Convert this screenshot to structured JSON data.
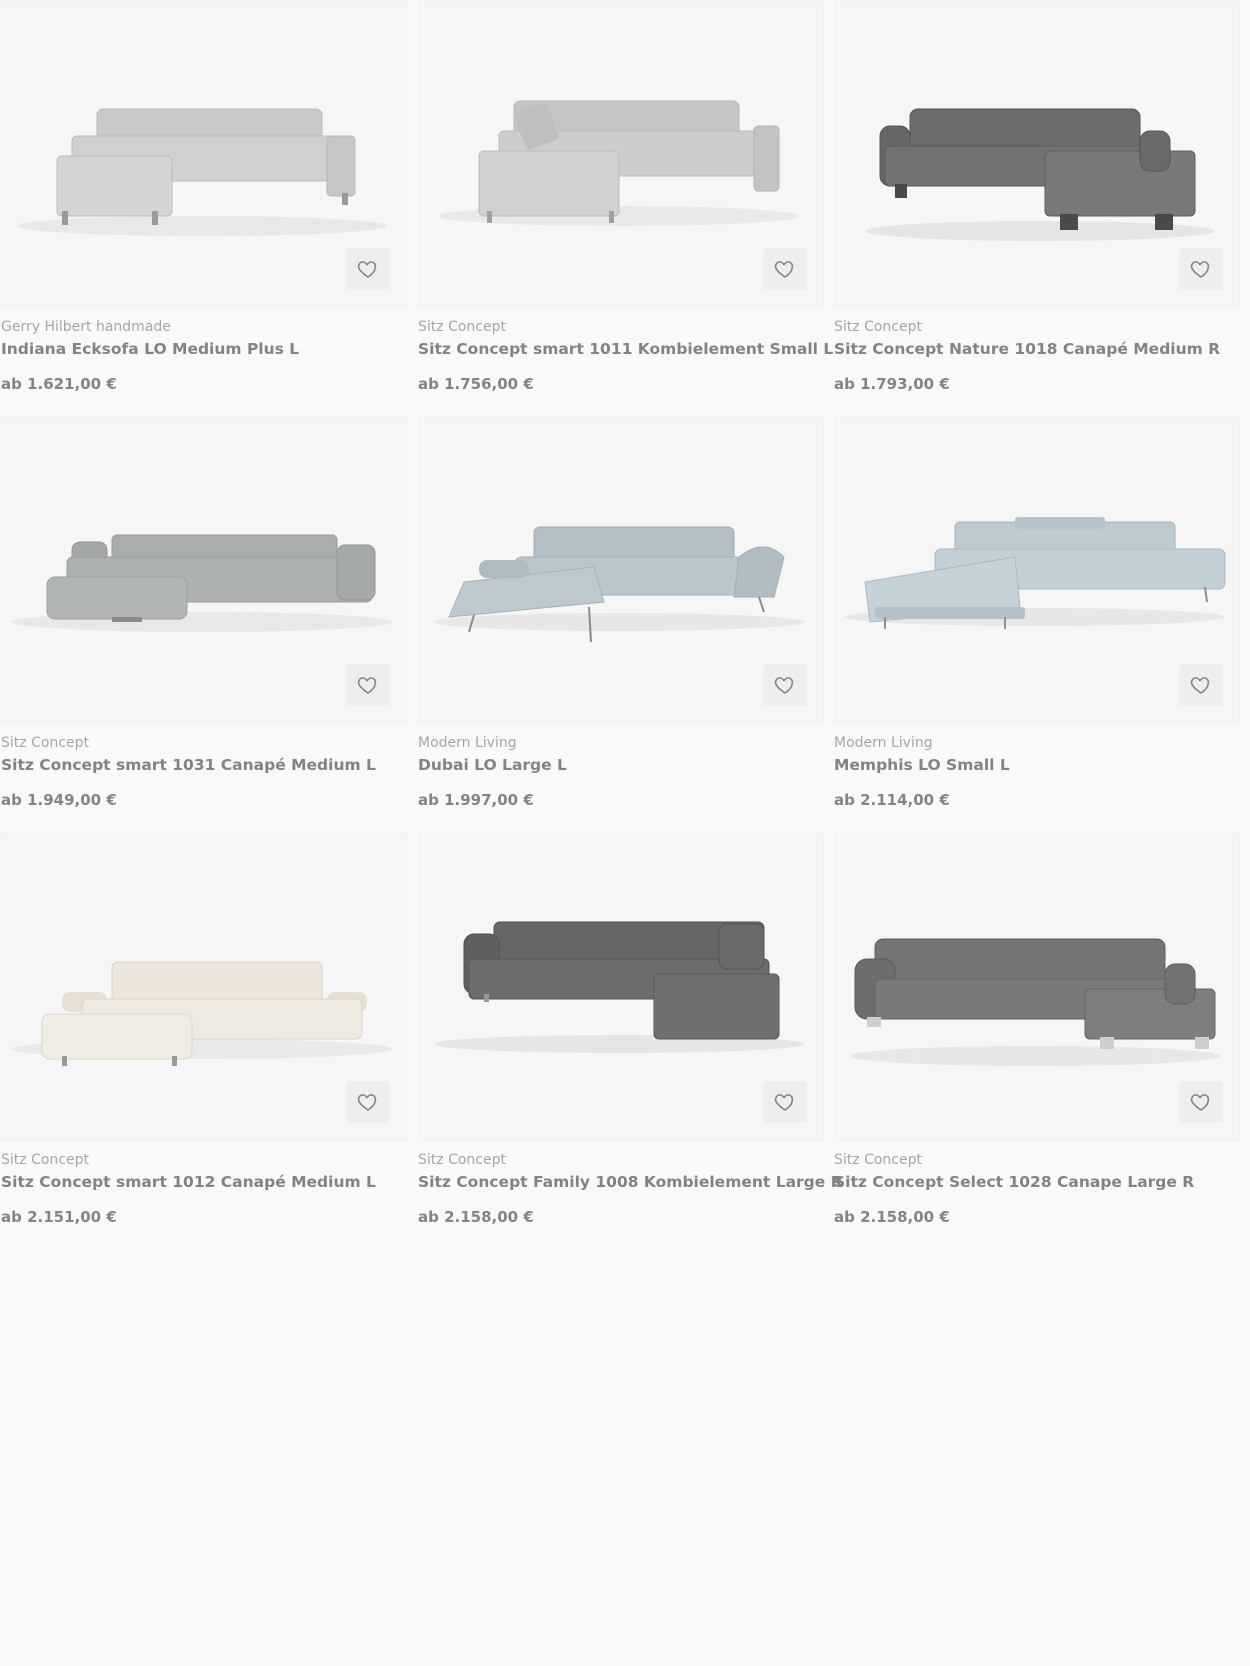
{
  "products": [
    {
      "brand": "Gerry Hilbert handmade",
      "title": "Indiana Ecksofa LO Medium Plus L",
      "price": "ab 1.621,00 €",
      "color": "#c9c9c9",
      "image": "l-sofa-left-chaise"
    },
    {
      "brand": "Sitz Concept",
      "title": "Sitz Concept smart 1011 Kombielement Small L",
      "price": "ab 1.756,00 €",
      "color": "#c5c5c5",
      "image": "l-sofa-left-chaise"
    },
    {
      "brand": "Sitz Concept",
      "title": "Sitz Concept Nature 1018 Canapé Medium R",
      "price": "ab 1.793,00 €",
      "color": "#6c6c6c",
      "image": "l-sofa-right-chaise"
    },
    {
      "brand": "Sitz Concept",
      "title": "Sitz Concept smart 1031 Canapé Medium L",
      "price": "ab 1.949,00 €",
      "color": "#a9adae",
      "image": "l-sofa-left-chaise"
    },
    {
      "brand": "Modern Living",
      "title": "Dubai LO Large L",
      "price": "ab 1.997,00 €",
      "color": "#b3c0c5",
      "image": "l-sofa-left-chaise"
    },
    {
      "brand": "Modern Living",
      "title": "Memphis LO Small L",
      "price": "ab 2.114,00 €",
      "color": "#bccbd2",
      "image": "l-sofa-left-chaise"
    },
    {
      "brand": "Sitz Concept",
      "title": "Sitz Concept smart 1012 Canapé Medium L",
      "price": "ab 2.151,00 €",
      "color": "#ece7da",
      "image": "l-sofa-left-chaise"
    },
    {
      "brand": "Sitz Concept",
      "title": "Sitz Concept Family 1008 Kombielement Large R",
      "price": "ab 2.158,00 €",
      "color": "#646668",
      "image": "corner-sofa-right"
    },
    {
      "brand": "Sitz Concept",
      "title": "Sitz Concept Select 1028 Canape Large R",
      "price": "ab 2.158,00 €",
      "color": "#727476",
      "image": "l-sofa-right-chaise"
    }
  ],
  "favorite_icon": "heart-outline-icon"
}
